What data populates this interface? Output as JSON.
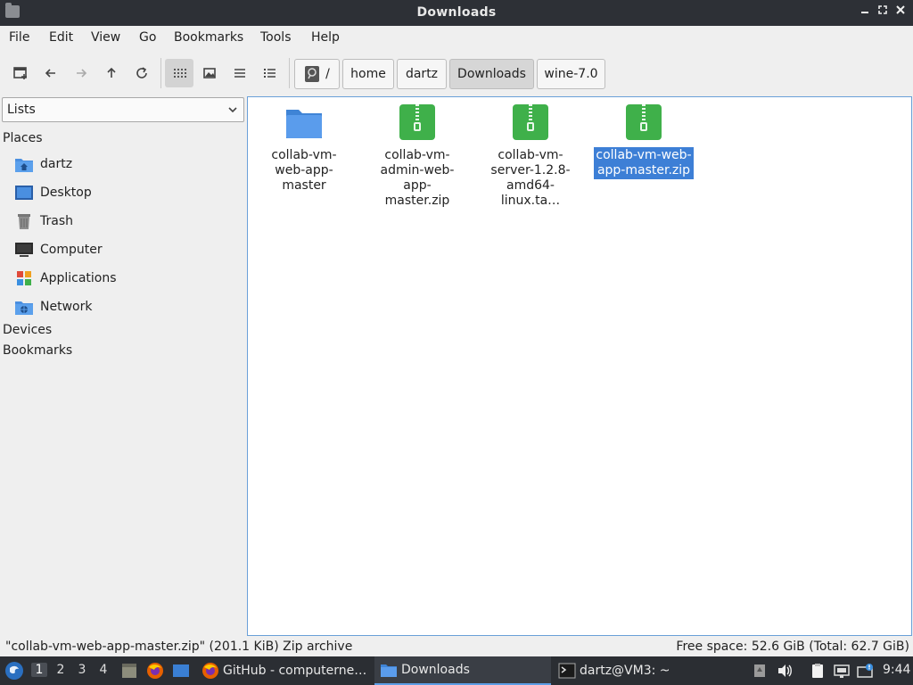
{
  "window": {
    "title": "Downloads"
  },
  "menu": [
    "File",
    "Edit",
    "View",
    "Go",
    "Bookmarks",
    "Tools",
    "Help"
  ],
  "breadcrumb": {
    "root_label": "/",
    "items": [
      "home",
      "dartz",
      "Downloads",
      "wine-7.0"
    ],
    "active": "Downloads"
  },
  "sidebar": {
    "select_value": "Lists",
    "places_header": "Places",
    "places": [
      {
        "label": "dartz",
        "icon": "home-folder-icon"
      },
      {
        "label": "Desktop",
        "icon": "desktop-icon"
      },
      {
        "label": "Trash",
        "icon": "trash-icon"
      },
      {
        "label": "Computer",
        "icon": "computer-icon"
      },
      {
        "label": "Applications",
        "icon": "applications-icon"
      },
      {
        "label": "Network",
        "icon": "network-icon"
      }
    ],
    "devices_header": "Devices",
    "bookmarks_header": "Bookmarks"
  },
  "files": [
    {
      "name": "collab-vm-web-app-master",
      "type": "folder"
    },
    {
      "name": "collab-vm-admin-web-app-master.zip",
      "display": "collab-vm-\nadmin-web-app-\nmaster.zip",
      "type": "zip"
    },
    {
      "name": "collab-vm-server-1.2.8-amd64-linux.ta…",
      "display": "collab-vm-\nserver-1.2.8-\namd64-linux.ta…",
      "type": "zip"
    },
    {
      "name": "collab-vm-web-app-master.zip",
      "display": "collab-vm-web-\napp-master.zip",
      "type": "zip",
      "selected": true
    }
  ],
  "status": {
    "left": "\"collab-vm-web-app-master.zip\" (201.1 KiB) Zip archive",
    "right": "Free space: 52.6 GiB (Total: 62.7 GiB)"
  },
  "taskbar": {
    "workspaces": [
      "1",
      "2",
      "3",
      "4"
    ],
    "active_workspace": "1",
    "tasks": [
      {
        "label": "GitHub - computerne…",
        "icon": "firefox-icon"
      },
      {
        "label": "Downloads",
        "icon": "folder-icon",
        "active": true
      },
      {
        "label": "dartz@VM3: ~",
        "icon": "terminal-icon"
      }
    ],
    "clock": "9:44"
  },
  "colors": {
    "titlebar": "#2d3036",
    "folder_blue": "#4a8fe0",
    "zip_green": "#3fb04a",
    "selection": "#3d7fd6",
    "taskbar": "#2b2e33"
  }
}
